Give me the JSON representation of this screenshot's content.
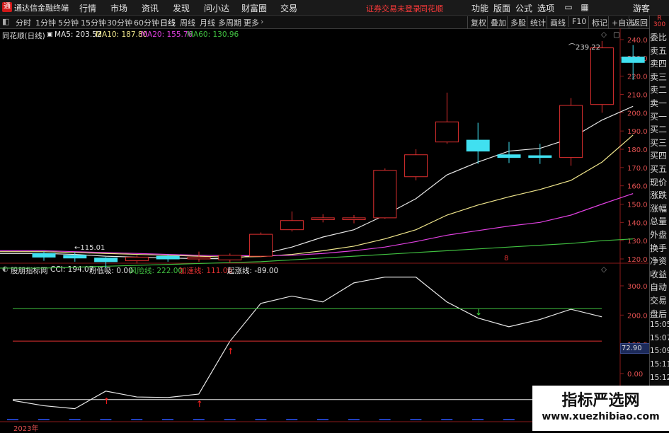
{
  "titlebar": {
    "logo": "通",
    "app_title": "通达信金融终端",
    "menus": [
      "行情",
      "市场",
      "资讯",
      "发现",
      "问小达",
      "财富圈",
      "交易"
    ],
    "login_notice": "证券交易未登录",
    "broker": "同花顺",
    "right_menus": [
      "功能",
      "版面",
      "公式",
      "选项"
    ],
    "guest": "游客"
  },
  "toolbar": {
    "periods": [
      "分时",
      "1分钟",
      "5分钟",
      "15分钟",
      "30分钟",
      "60分钟",
      "日线",
      "周线",
      "月线",
      "多周期",
      "更多"
    ],
    "active_period": "日线",
    "tools": [
      "复权",
      "叠加",
      "多股",
      "统计",
      "画线",
      "F10",
      "标记",
      "+自选",
      "返回"
    ]
  },
  "main_chart": {
    "stock_label": "同花顺(日线)",
    "ma_labels": [
      {
        "text": "MA5: 203.52",
        "color": "#e8e8e8"
      },
      {
        "text": "MA10: 187.80",
        "color": "#f0e68c"
      },
      {
        "text": "MA20: 155.76",
        "color": "#e040e0"
      },
      {
        "text": "MA60: 130.96",
        "color": "#40c040"
      }
    ],
    "high_annotation": "239.22",
    "low_annotation": "115.01",
    "marker": "8"
  },
  "indicator": {
    "name": "股朋指标网",
    "labels": [
      {
        "text": "CCI: 194.07",
        "color": "#e8e8e8"
      },
      {
        "text": "粉低吸: 0.00",
        "color": "#e8e8e8"
      },
      {
        "text": "风险线: 222.00",
        "color": "#40c040"
      },
      {
        "text": "加速线: 111.00",
        "color": "#e03030"
      },
      {
        "text": "起涨线: -89.00",
        "color": "#e8e8e8"
      }
    ],
    "current_value_box": "72.90"
  },
  "year_label": "2023年",
  "side_panel": {
    "corner": "R",
    "corner_code": "300",
    "items": [
      "委比",
      "卖五",
      "卖四",
      "卖三",
      "卖二",
      "卖一",
      "买一",
      "买二",
      "买三",
      "买四",
      "买五",
      "现价",
      "涨跌",
      "涨幅",
      "总量",
      "外盘",
      "换手",
      "净资",
      "收益",
      "自动",
      "交易",
      "盘后",
      "15:05",
      "15:07",
      "15:09",
      "15:11",
      "15:12",
      "15:14",
      "15:14"
    ]
  },
  "watermark": {
    "line1": "指标严选网",
    "line2": "www.xuezhibiao.com"
  },
  "chart_data": [
    {
      "type": "candlestick",
      "title": "同花顺(日线)",
      "ylim": [
        110,
        245
      ],
      "y_ticks": [
        120,
        130,
        140,
        150,
        160,
        170,
        180,
        190,
        200,
        210,
        220,
        230,
        240
      ],
      "candles": [
        {
          "o": 123.0,
          "c": 121.0,
          "h": 124.0,
          "l": 119.0
        },
        {
          "o": 122.0,
          "c": 120.5,
          "h": 123.5,
          "l": 118.5
        },
        {
          "o": 120.5,
          "c": 118.5,
          "h": 121.0,
          "l": 115.01
        },
        {
          "o": 119.0,
          "c": 121.0,
          "h": 122.0,
          "l": 117.5
        },
        {
          "o": 121.5,
          "c": 120.0,
          "h": 122.5,
          "l": 118.5
        },
        {
          "o": 120.0,
          "c": 121.0,
          "h": 124.0,
          "l": 118.5
        },
        {
          "o": 119.5,
          "c": 122.0,
          "h": 123.0,
          "l": 118.0
        },
        {
          "o": 121.5,
          "c": 133.5,
          "h": 134.5,
          "l": 121.0
        },
        {
          "o": 136.0,
          "c": 141.0,
          "h": 146.0,
          "l": 135.0
        },
        {
          "o": 141.5,
          "c": 142.5,
          "h": 144.5,
          "l": 140.0
        },
        {
          "o": 141.5,
          "c": 142.5,
          "h": 144.0,
          "l": 139.5
        },
        {
          "o": 142.5,
          "c": 168.5,
          "h": 169.5,
          "l": 142.0
        },
        {
          "o": 165.0,
          "c": 177.0,
          "h": 180.0,
          "l": 163.0
        },
        {
          "o": 184.0,
          "c": 195.0,
          "h": 211.0,
          "l": 183.0
        },
        {
          "o": 185.0,
          "c": 179.0,
          "h": 194.5,
          "l": 172.0
        },
        {
          "o": 177.0,
          "c": 175.5,
          "h": 184.0,
          "l": 172.5
        },
        {
          "o": 176.5,
          "c": 175.5,
          "h": 183.0,
          "l": 172.0
        },
        {
          "o": 175.5,
          "c": 204.0,
          "h": 208.0,
          "l": 171.0
        },
        {
          "o": 204.5,
          "c": 235.5,
          "h": 239.22,
          "l": 200.0
        },
        {
          "o": 230.5,
          "c": 227.5,
          "h": 237.0,
          "l": 218.0
        }
      ],
      "series": [
        {
          "name": "MA5",
          "color": "#e8e8e8",
          "values": [
            123,
            122.5,
            121.5,
            121,
            120.5,
            120.2,
            120.1,
            122.5,
            126.5,
            132,
            136,
            144,
            153,
            166,
            173,
            179,
            180.5,
            186,
            196,
            203.52
          ]
        },
        {
          "name": "MA10",
          "color": "#f0e68c",
          "values": [
            124,
            123.5,
            123,
            122.5,
            122,
            121.5,
            121,
            121.3,
            122.5,
            124.5,
            127,
            131,
            136,
            144,
            149.5,
            154,
            158,
            163,
            173,
            187.8
          ]
        },
        {
          "name": "MA20",
          "color": "#e040e0",
          "values": [
            124.5,
            124,
            123.5,
            123,
            122.5,
            122,
            121.8,
            121.8,
            122,
            123,
            124.5,
            126.5,
            129.5,
            133,
            135.5,
            138,
            140,
            144,
            150,
            155.76
          ]
        },
        {
          "name": "MA60",
          "color": "#40c040",
          "values": [
            115,
            115.5,
            116,
            116.5,
            117,
            117.5,
            118,
            118.5,
            119.5,
            120.5,
            121.5,
            122.5,
            123.5,
            124.5,
            125.5,
            126.5,
            127.5,
            128.5,
            130,
            130.96
          ]
        }
      ]
    },
    {
      "type": "line",
      "title": "股朋指标网",
      "ylim": [
        -100,
        350
      ],
      "y_ticks": [
        300,
        200,
        100,
        0
      ],
      "y_tick_labels": [
        "300.0",
        "200.0",
        "100.0",
        "0.00"
      ],
      "series": [
        {
          "name": "CCI",
          "color": "#e8e8e8",
          "values": [
            -92,
            -110,
            -120,
            -60,
            -80,
            -82,
            -70,
            110,
            240,
            265,
            245,
            310,
            330,
            330,
            245,
            190,
            160,
            185,
            220,
            194.07
          ]
        },
        {
          "name": "风险线",
          "color": "#40c040",
          "values": [
            222,
            222,
            222,
            222,
            222,
            222,
            222,
            222,
            222,
            222,
            222,
            222,
            222,
            222,
            222,
            222,
            222,
            222,
            222,
            222
          ]
        },
        {
          "name": "加速线",
          "color": "#e03030",
          "values": [
            111,
            111,
            111,
            111,
            111,
            111,
            111,
            111,
            111,
            111,
            111,
            111,
            111,
            111,
            111,
            111,
            111,
            111,
            111,
            111
          ]
        },
        {
          "name": "起涨线",
          "color": "#e8e8e8",
          "values": [
            -89,
            -89,
            -89,
            -89,
            -89,
            -89,
            -89,
            -89,
            -89,
            -89,
            -89,
            -89,
            -89,
            -89,
            -89,
            -89,
            -89,
            -89,
            -89,
            -89
          ]
        }
      ],
      "buy_arrows_at": [
        3,
        6,
        7
      ],
      "sell_arrows_at": [
        15
      ]
    }
  ]
}
